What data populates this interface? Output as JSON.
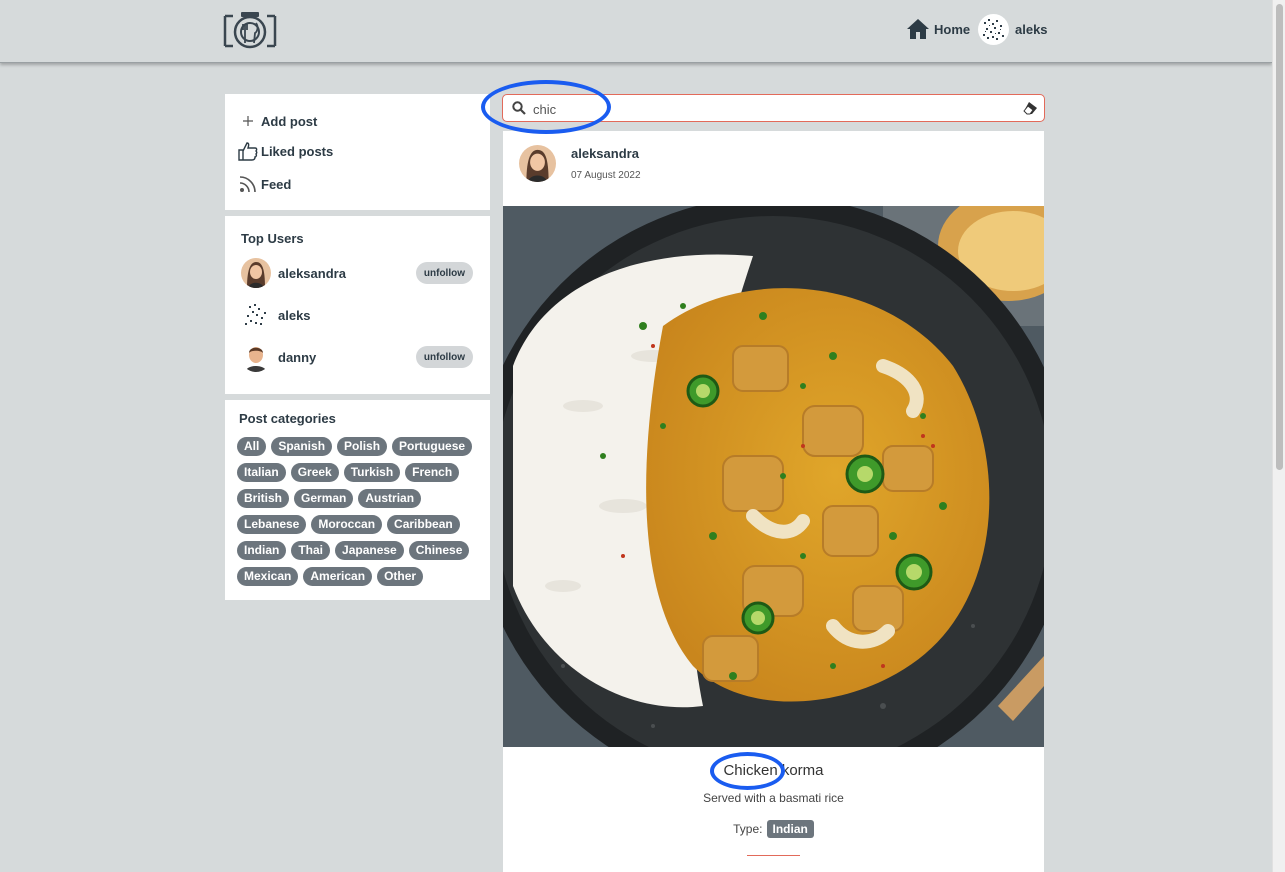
{
  "nav": {
    "logo_icon": "camera-plate-logo",
    "home_label": "Home",
    "user_label": "aleks"
  },
  "menu": {
    "items": [
      {
        "icon": "plus-icon",
        "label": "Add post"
      },
      {
        "icon": "thumbs-up-icon",
        "label": "Liked posts"
      },
      {
        "icon": "rss-icon",
        "label": "Feed"
      }
    ]
  },
  "top_users": {
    "title": "Top Users",
    "users": [
      {
        "name": "aleksandra",
        "button": "unfollow"
      },
      {
        "name": "aleks",
        "button": ""
      },
      {
        "name": "danny",
        "button": "unfollow"
      }
    ]
  },
  "categories": {
    "title": "Post categories",
    "items": [
      "All",
      "Spanish",
      "Polish",
      "Portuguese",
      "Italian",
      "Greek",
      "Turkish",
      "French",
      "British",
      "German",
      "Austrian",
      "Lebanese",
      "Moroccan",
      "Caribbean",
      "Indian",
      "Thai",
      "Japanese",
      "Chinese",
      "Mexican",
      "American",
      "Other"
    ]
  },
  "search": {
    "value": "chic",
    "icon": "search-icon",
    "clear_icon": "eraser-icon"
  },
  "post": {
    "author": "aleksandra",
    "date": "07 August 2022",
    "title": "Chicken korma",
    "description": "Served with a basmati rice",
    "type_label": "Type:",
    "type_value": "Indian"
  },
  "colors": {
    "page_bg": "#d6dadb",
    "chip_bg": "#6c757d",
    "accent": "#e26a5a",
    "annotation": "#1a5cf0"
  }
}
